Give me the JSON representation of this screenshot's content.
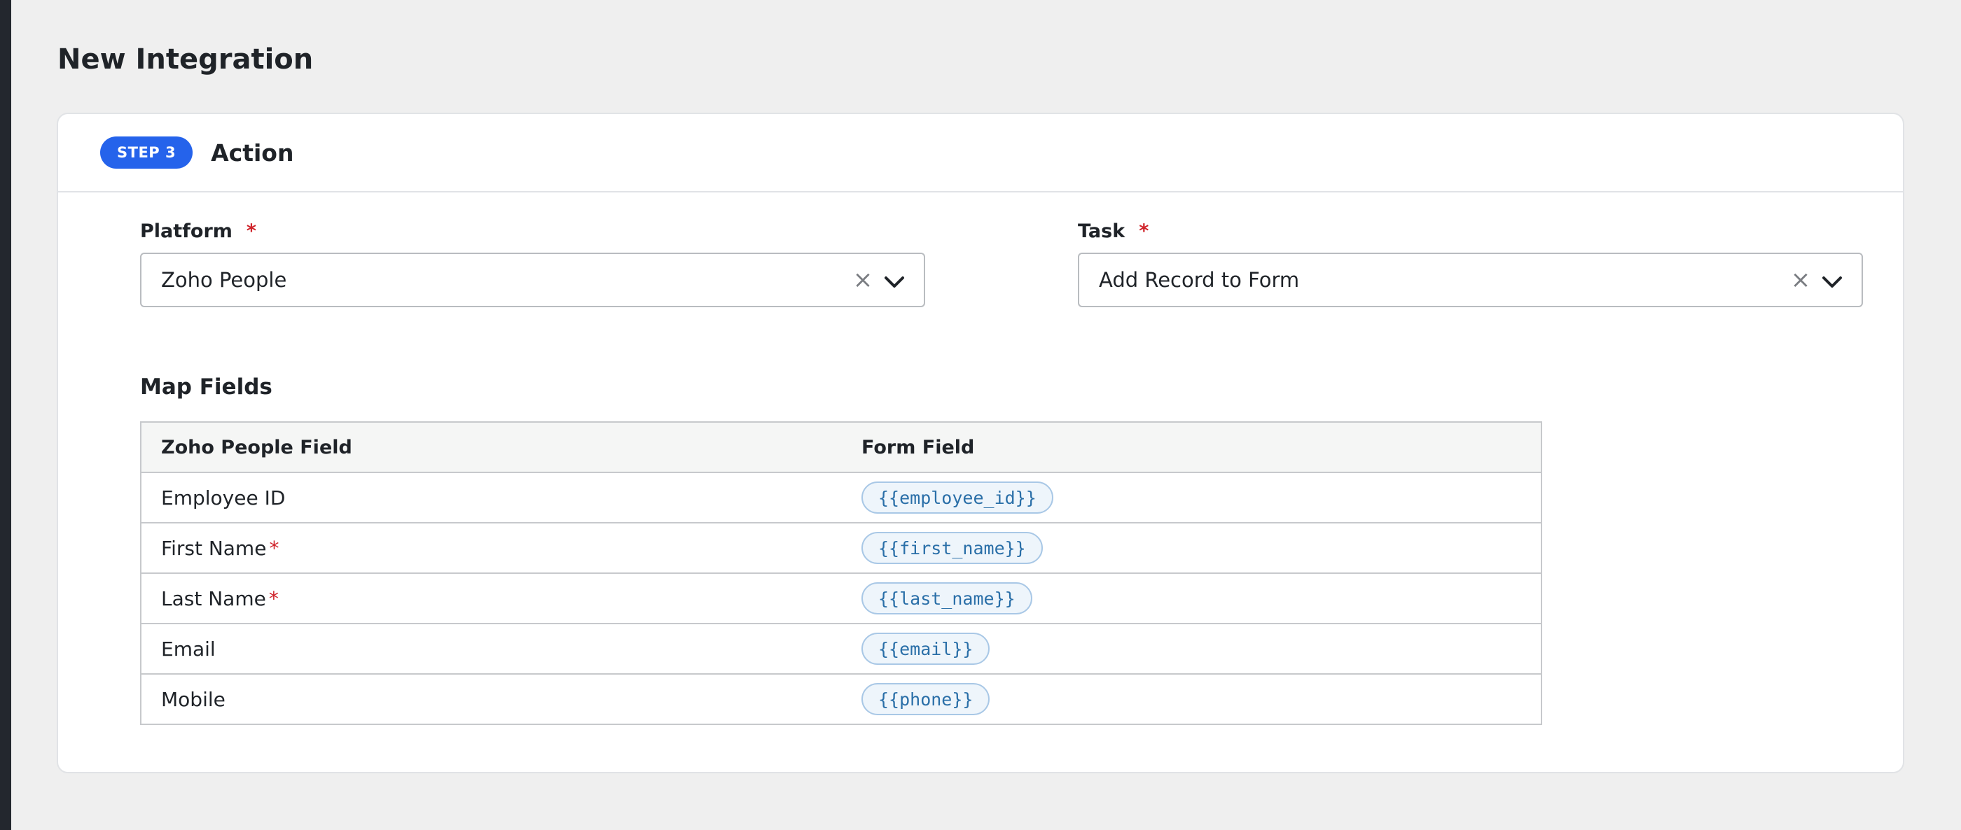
{
  "page": {
    "title": "New Integration"
  },
  "step": {
    "badge": "STEP 3",
    "title": "Action"
  },
  "platform": {
    "label": "Platform",
    "required_mark": "*",
    "value": "Zoho People"
  },
  "task": {
    "label": "Task",
    "required_mark": "*",
    "value": "Add Record to Form"
  },
  "clear_glyph": "×",
  "map": {
    "title": "Map Fields",
    "headers": [
      "Zoho People Field",
      "Form Field"
    ],
    "rows": [
      {
        "field": "Employee ID",
        "required": "",
        "token": "{{employee_id}}"
      },
      {
        "field": "First Name",
        "required": "*",
        "token": "{{first_name}}"
      },
      {
        "field": "Last Name",
        "required": "*",
        "token": "{{last_name}}"
      },
      {
        "field": "Email",
        "required": "",
        "token": "{{email}}"
      },
      {
        "field": "Mobile",
        "required": "",
        "token": "{{phone}}"
      }
    ]
  },
  "colors": {
    "accent": "#2563eb",
    "required": "#d0242b",
    "token_text": "#2a6fa8"
  },
  "icons": {
    "clear": "close-icon",
    "dropdown": "chevron-down-icon"
  }
}
